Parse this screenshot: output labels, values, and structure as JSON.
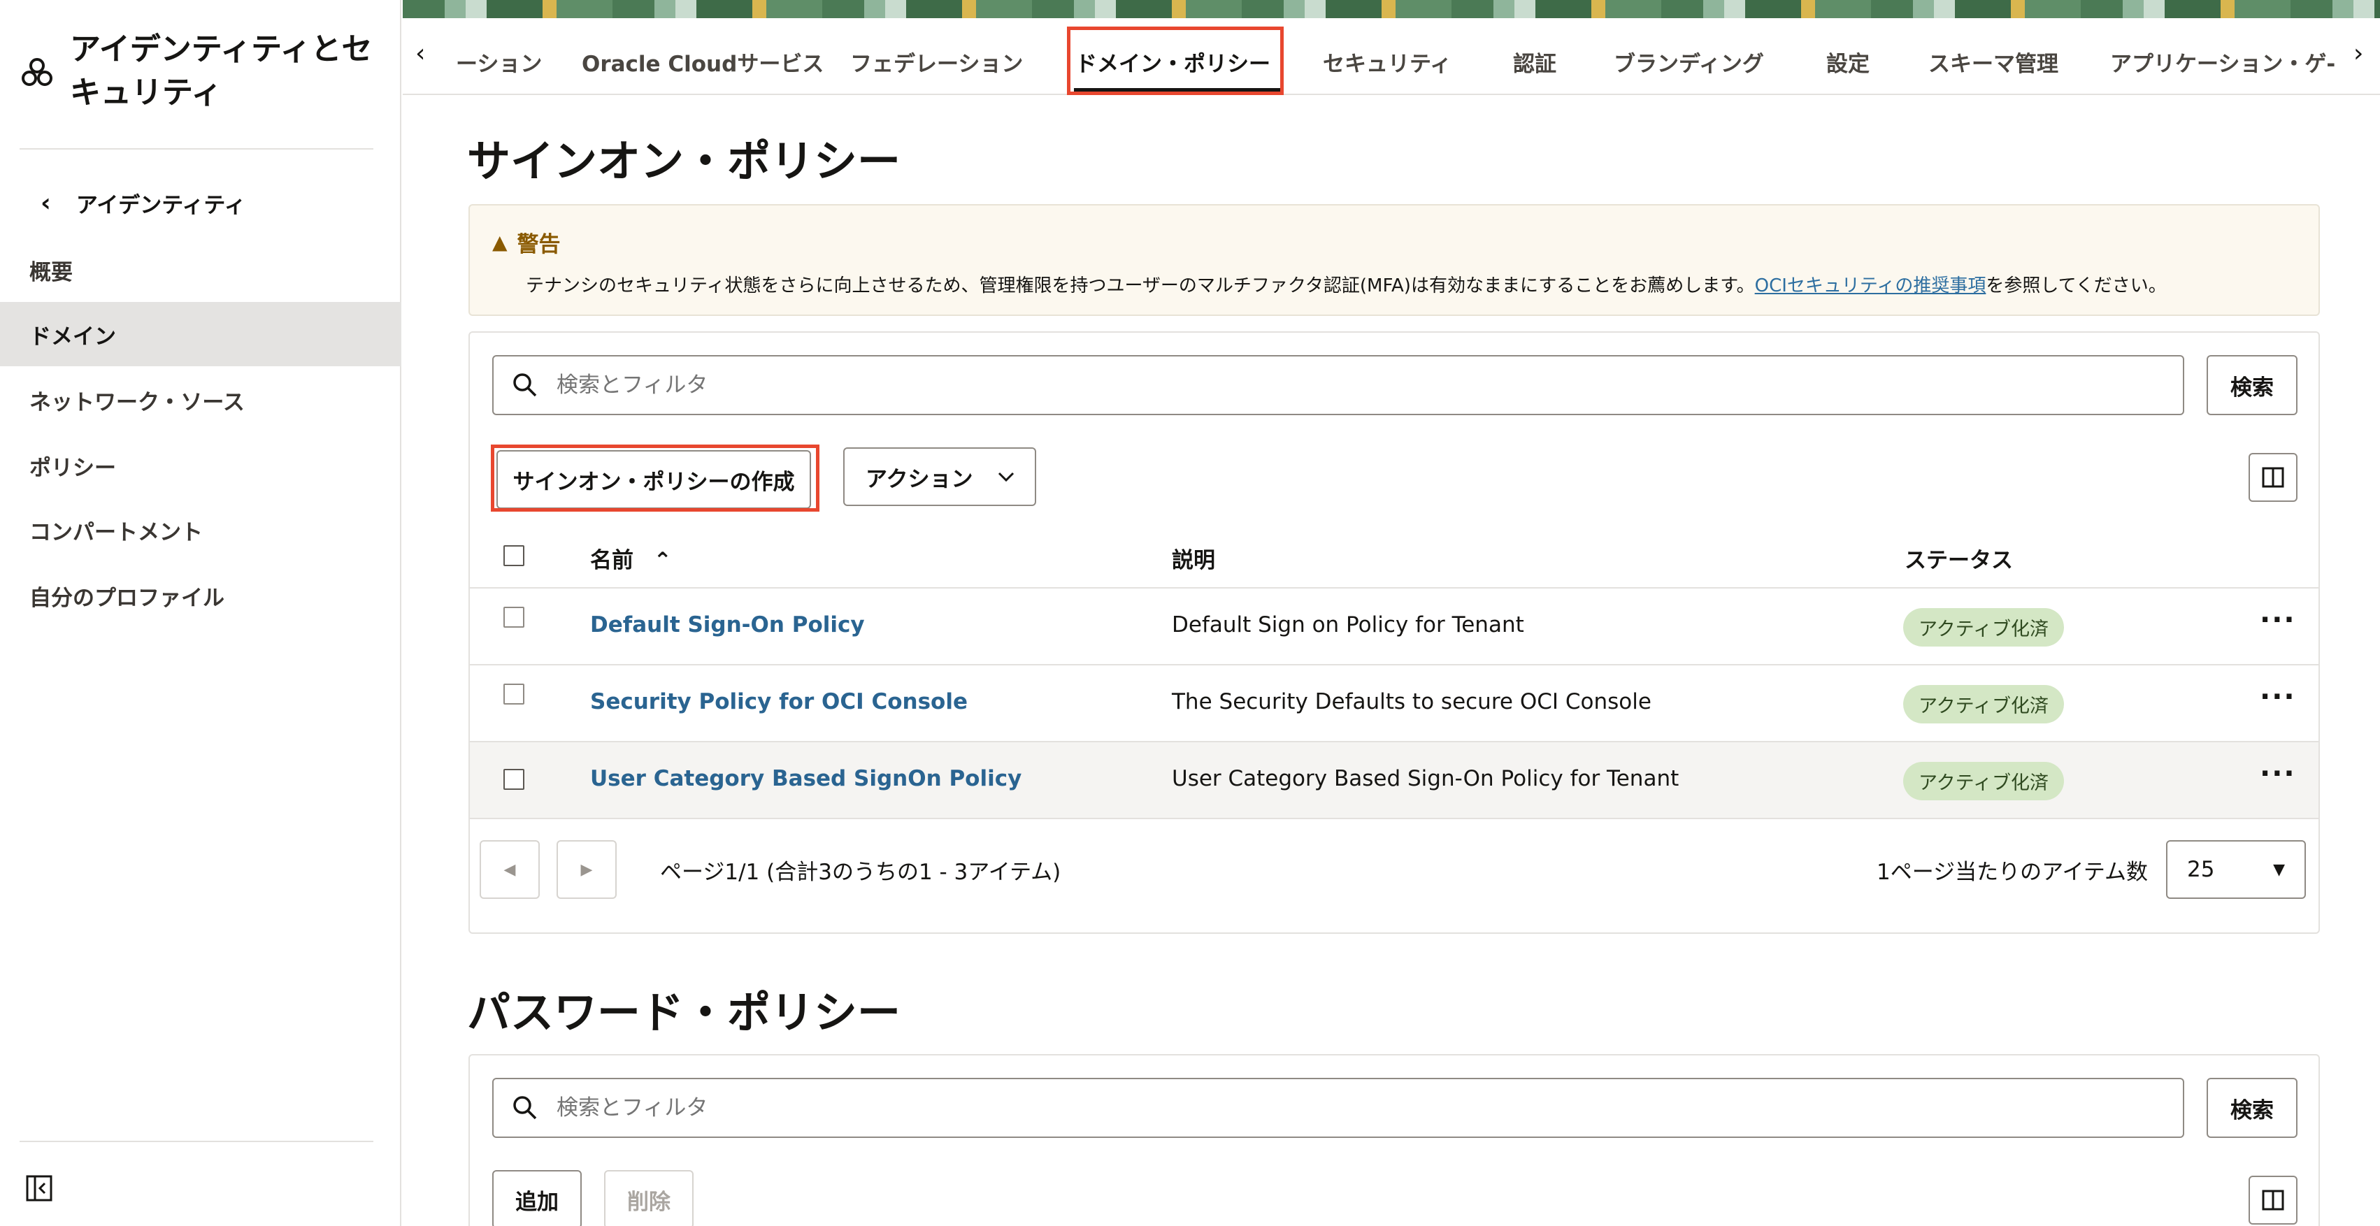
{
  "sidebar": {
    "title": "アイデンティティとセキュリティ",
    "back_label": "アイデンティティ",
    "items": [
      {
        "label": "概要"
      },
      {
        "label": "ドメイン"
      },
      {
        "label": "ネットワーク・ソース"
      },
      {
        "label": "ポリシー"
      },
      {
        "label": "コンパートメント"
      },
      {
        "label": "自分のプロファイル"
      }
    ],
    "active_item": "ドメイン"
  },
  "tabs": [
    {
      "label": "ーション"
    },
    {
      "label": "Oracle Cloudサービス"
    },
    {
      "label": "フェデレーション"
    },
    {
      "label": "ドメイン・ポリシー"
    },
    {
      "label": "セキュリティ"
    },
    {
      "label": "認証"
    },
    {
      "label": "ブランディング"
    },
    {
      "label": "設定"
    },
    {
      "label": "スキーマ管理"
    },
    {
      "label": "アプリケーション・ゲ-"
    }
  ],
  "selected_tab": "ドメイン・ポリシー",
  "signon": {
    "heading": "サインオン・ポリシー",
    "warning": {
      "title": "警告",
      "text_before": "テナンシのセキュリティ状態をさらに向上させるため、管理権限を持つユーザーのマルチファクタ認証(MFA)は有効なままにすることをお薦めします。",
      "link": "OCIセキュリティの推奨事項",
      "text_after": "を参照してください。"
    },
    "search_placeholder": "検索とフィルタ",
    "search_button": "検索",
    "create_button": "サインオン・ポリシーの作成",
    "actions_button": "アクション",
    "columns": {
      "name": "名前",
      "description": "説明",
      "status": "ステータス"
    },
    "rows": [
      {
        "name": "Default Sign-On Policy",
        "description": "Default Sign on Policy for Tenant",
        "status": "アクティブ化済"
      },
      {
        "name": "Security Policy for OCI Console",
        "description": "The Security Defaults to secure OCI Console",
        "status": "アクティブ化済"
      },
      {
        "name": "User Category Based SignOn Policy",
        "description": "User Category Based Sign-On Policy for Tenant",
        "status": "アクティブ化済"
      }
    ],
    "pager_text": "ページ1/1 (合計3のうちの1 - 3アイテム)",
    "per_page_label": "1ページ当たりのアイテム数",
    "per_page_value": "25"
  },
  "password": {
    "heading": "パスワード・ポリシー",
    "search_placeholder": "検索とフィルタ",
    "search_button": "検索",
    "add_button": "追加",
    "delete_button": "削除"
  },
  "colors": {
    "highlight": "#e8472f",
    "link": "#2a6491",
    "badge_bg": "#d4e7c5"
  }
}
